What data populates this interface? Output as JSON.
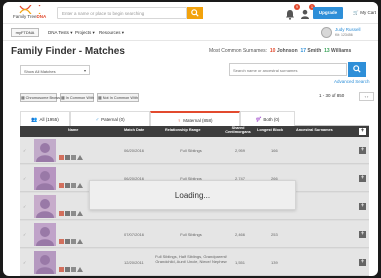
{
  "header": {
    "logo_text": "Family Tree DNA",
    "logo_plain": "Family Tree",
    "logo_accent": "DNA",
    "search_placeholder": "Enter a name or place to begin searching",
    "notif_count": "9",
    "messages_count": "1",
    "upgrade_label": "Upgrade",
    "cart_label": "My Cart"
  },
  "subnav": {
    "site_button": "myFTDNA",
    "items": [
      "DNA Tests",
      "Projects",
      "Resources"
    ],
    "user_name": "Judy Russell",
    "user_kit": "Kit: 123456"
  },
  "page": {
    "title": "Family Finder - Matches",
    "common_label": "Most Common Surnames:",
    "common_surnames": [
      {
        "count": "10",
        "name": "Johnson"
      },
      {
        "count": "17",
        "name": "Smith"
      },
      {
        "count": "13",
        "name": "Williams"
      }
    ]
  },
  "filters": {
    "show_all": "Show All Matches",
    "surname_placeholder": "Search name or ancestral surnames",
    "advanced_search": "Advanced Search",
    "tools": [
      "Chromosome Browser",
      "In Common With",
      "Not In Common With"
    ],
    "pager": "1 - 30 of 850"
  },
  "tabs": [
    {
      "label": "All (1955)",
      "icon": "people-icon"
    },
    {
      "label": "Paternal (0)",
      "icon": "male-icon"
    },
    {
      "label": "Maternal (858)",
      "icon": "female-icon"
    },
    {
      "label": "Both (0)",
      "icon": "both-icon"
    }
  ],
  "table": {
    "headers": [
      "Name",
      "Match Date",
      "Relationship Range",
      "Shared Centimorgans",
      "Longest Block",
      "Ancestral Surnames"
    ],
    "rows": [
      {
        "date": "06/20/2016",
        "relationship": "Full Siblings",
        "shared": "2,959",
        "longest": "166",
        "surnames": ""
      },
      {
        "date": "06/20/2016",
        "relationship": "Full Siblings",
        "shared": "2,747",
        "longest": "266",
        "surnames": ""
      },
      {
        "date": "06/20/2016",
        "relationship": "Full Siblings",
        "shared": "2,596",
        "longest": "252",
        "surnames": ""
      },
      {
        "date": "07/07/2016",
        "relationship": "Full Siblings",
        "shared": "2,466",
        "longest": "253",
        "surnames": ""
      },
      {
        "date": "12/20/2011",
        "relationship": "Full Siblings, Half Siblings, Grandparent/ Grandchild, Aunt/ Uncle, Niece/ Nephew",
        "shared": "1,551",
        "longest": "139",
        "surnames": ""
      }
    ],
    "loading_text": "Loading..."
  }
}
